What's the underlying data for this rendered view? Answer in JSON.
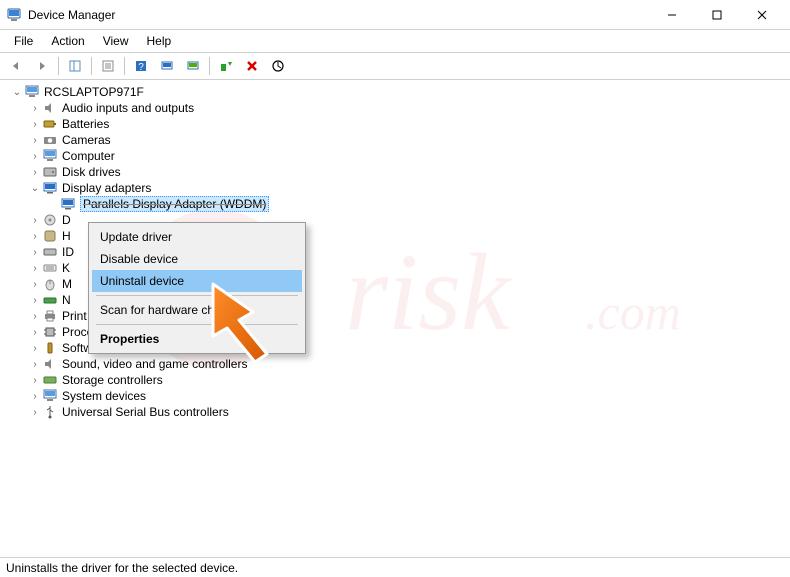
{
  "window": {
    "title": "Device Manager"
  },
  "menu": {
    "file": "File",
    "action": "Action",
    "view": "View",
    "help": "Help"
  },
  "tree": {
    "root": "RCSLAPTOP971F",
    "items": [
      {
        "label": "Audio inputs and outputs"
      },
      {
        "label": "Batteries"
      },
      {
        "label": "Cameras"
      },
      {
        "label": "Computer"
      },
      {
        "label": "Disk drives"
      },
      {
        "label": "Display adapters",
        "expanded": true
      },
      {
        "label": "Parallels Display Adapter (WDDM)",
        "child": true,
        "selected": true
      },
      {
        "label": "D"
      },
      {
        "label": "H"
      },
      {
        "label": "ID"
      },
      {
        "label": "K"
      },
      {
        "label": "M"
      },
      {
        "label": "N"
      },
      {
        "label": "Print queues"
      },
      {
        "label": "Processors"
      },
      {
        "label": "Software devices"
      },
      {
        "label": "Sound, video and game controllers"
      },
      {
        "label": "Storage controllers"
      },
      {
        "label": "System devices"
      },
      {
        "label": "Universal Serial Bus controllers"
      }
    ]
  },
  "context_menu": {
    "update": "Update driver",
    "disable": "Disable device",
    "uninstall": "Uninstall device",
    "scan": "Scan for hardware changes",
    "properties": "Properties"
  },
  "status": {
    "text": "Uninstalls the driver for the selected device."
  }
}
